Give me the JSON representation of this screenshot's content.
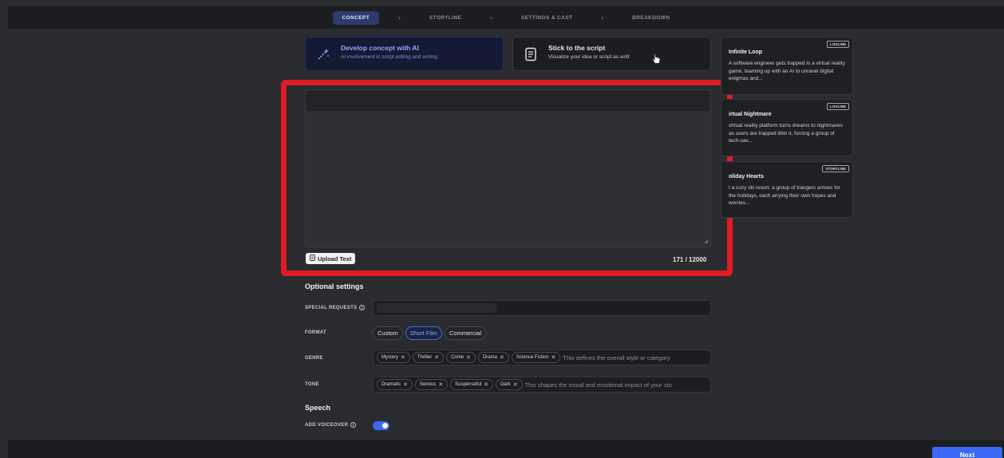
{
  "steps": [
    {
      "label": "CONCEPT"
    },
    {
      "label": "STORYLINE"
    },
    {
      "label": "SETTINGS & CAST"
    },
    {
      "label": "BREAKDOWN"
    }
  ],
  "mode_cards": {
    "ai": {
      "title": "Develop concept with AI",
      "subtitle": "AI involvement in script editing and writing",
      "icon": "magic-wand-icon"
    },
    "script": {
      "title": "Stick to the script",
      "subtitle": "Visualize your idea or script as writt",
      "icon": "document-icon"
    }
  },
  "editor": {
    "upload_label": "Upload Text",
    "char_count": "171 / 12000"
  },
  "optional_settings": {
    "title": "Optional settings",
    "special_requests_label": "SPECIAL REQUESTS",
    "format_label": "FORMAT",
    "formats": [
      "Custom",
      "Short Film",
      "Commercial"
    ],
    "selected_format": "Short Film",
    "genre_label": "GENRE",
    "genres": [
      "Mystery",
      "Thriller",
      "Crime",
      "Drama",
      "Science Fiction"
    ],
    "genre_placeholder": "This defines the overall style or category",
    "tone_label": "TONE",
    "tones": [
      "Dramatic",
      "Serious",
      "Suspenseful",
      "Dark"
    ],
    "tone_placeholder": "This shapes the mood and emotional impact of your sto"
  },
  "speech": {
    "title": "Speech",
    "voiceover_label": "ADD VOICEOVER",
    "voiceover_enabled": true
  },
  "suggestions": [
    {
      "badge": "LOGLINE",
      "title": "Infinite Loop",
      "text": "A software engineer gets trapped in a virtual reality game, teaming up with an AI to unravel digital enigmas and..."
    },
    {
      "badge": "LOGLINE",
      "title": "irtual Nightmare",
      "text": "virtual reality platform turns dreams to nightmares as users are trapped ithin it, forcing a group of tech-sav..."
    },
    {
      "badge": "STORYLINE",
      "title": "oliday Hearts",
      "text": "t a cozy ski resort, a group of trangers arrives for the holidays, each arrying their own hopes and worries..."
    }
  ],
  "footer": {
    "next_label": "Next"
  },
  "colors": {
    "accent": "#3a68f5",
    "highlight": "#e01b24",
    "background": "#2a2b2e"
  }
}
